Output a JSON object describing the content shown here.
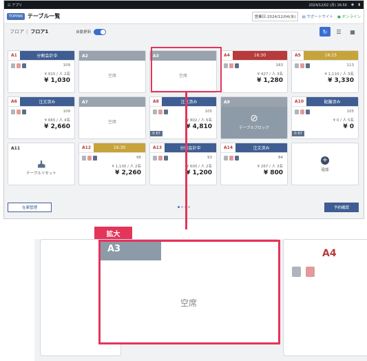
{
  "statusbar": {
    "app": "☷ アプリ",
    "clock": "2024/12/02 (月) 16:50",
    "wifi": "◉",
    "battery": "▮"
  },
  "header": {
    "badge": "TOPPAN",
    "title": "テーブル一覧",
    "business_date": "営業日:2024/12/04(水)",
    "support": "▤ サポートサイト",
    "online": "● オンライン"
  },
  "floorbar": {
    "floor_label": "フロア",
    "floor": "フロア1",
    "auto_label": "自動更新"
  },
  "tiles": [
    {
      "name": "A1",
      "status": "分割会計中",
      "state": "occ",
      "cnt": "109",
      "sub": "¥ 915 / 人 2名",
      "total": "¥ 1,030"
    },
    {
      "name": "A2",
      "state": "emp",
      "body": "空席"
    },
    {
      "name": "A3",
      "state": "emp",
      "body": "空席"
    },
    {
      "name": "A4",
      "status": "16:30",
      "state": "occ",
      "cnt": "183",
      "sub": "¥ 427 / 人 3名",
      "total": "¥ 1,280"
    },
    {
      "name": "A5",
      "status": "16:15",
      "state": "occ",
      "cnt": "113",
      "sub": "¥ 1,110 / 人 3名",
      "total": "¥ 3,330"
    },
    {
      "name": "A6",
      "status": "注文済み",
      "state": "occ",
      "cnt": "109",
      "sub": "¥ 665 / 人 4名",
      "total": "¥ 2,660"
    },
    {
      "name": "A7",
      "state": "emp",
      "body": "空席"
    },
    {
      "name": "A8",
      "status": "注文済み",
      "state": "occ",
      "cnt": "105",
      "sub": "¥ 802 / 人 6名",
      "total": "¥ 4,810",
      "elapsed": "⏱ 67"
    },
    {
      "name": "A9",
      "state": "blocked",
      "body": "テーブルブロック",
      "symbol": "⊘"
    },
    {
      "name": "A10",
      "status": "配膳済み",
      "state": "occ",
      "cnt": "105",
      "sub": "¥ 0 / 人 5名",
      "total": "¥ 0",
      "elapsed": "⏱ 67"
    },
    {
      "name": "A11",
      "state": "reset",
      "body": "テーブルリセット"
    },
    {
      "name": "A12",
      "status": "16:30",
      "state": "occ",
      "cnt": "96",
      "sub": "¥ 1,130 / 人 2名",
      "total": "¥ 2,260"
    },
    {
      "name": "A13",
      "status": "分割会計中",
      "state": "occ",
      "cnt": "93",
      "sub": "¥ 600 / 人 2名",
      "total": "¥ 1,200"
    },
    {
      "name": "A14",
      "status": "注文済み",
      "state": "occ",
      "cnt": "84",
      "sub": "¥ 267 / 人 3名",
      "total": "¥ 800"
    },
    {
      "name": "",
      "state": "add",
      "body": "追加"
    }
  ],
  "footer": {
    "inventory": "在庫管理",
    "reservation": "予約確認"
  },
  "zoom": {
    "tag": "拡大",
    "table": "A3",
    "vacant": "空席",
    "next_table": "A4"
  },
  "colors": {
    "highlight": "#e5345a",
    "header_blue": "#3f5d92",
    "occupied_red": "#b83a3a",
    "timer_gold": "#c7a33b"
  }
}
